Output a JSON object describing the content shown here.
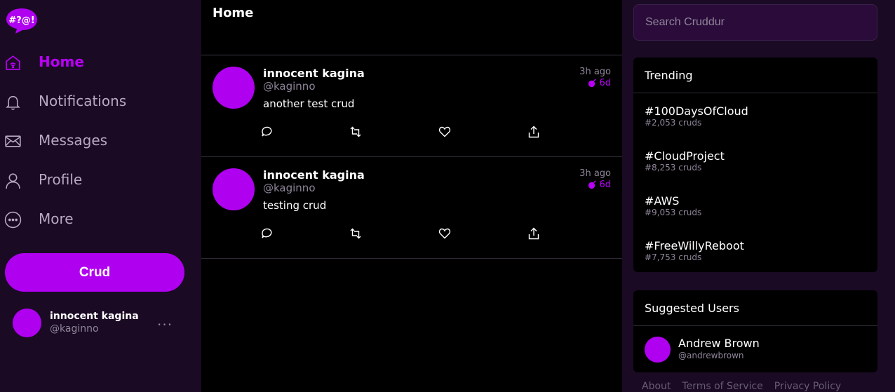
{
  "brand": {
    "logo_text": "#?@!",
    "accent": "#b000f0",
    "background": "#1a0a24"
  },
  "nav": {
    "items": [
      {
        "label": "Home",
        "icon": "home-icon",
        "active": true
      },
      {
        "label": "Notifications",
        "icon": "bell-icon",
        "active": false
      },
      {
        "label": "Messages",
        "icon": "envelope-icon",
        "active": false
      },
      {
        "label": "Profile",
        "icon": "person-icon",
        "active": false
      },
      {
        "label": "More",
        "icon": "more-circle-icon",
        "active": false
      }
    ],
    "crud_button": "Crud"
  },
  "current_user": {
    "name": "innocent kagina",
    "handle": "@kaginno",
    "more": "..."
  },
  "feed": {
    "title": "Home",
    "posts": [
      {
        "name": "innocent kagina",
        "handle": "@kaginno",
        "text": "another test crud",
        "time": "3h ago",
        "expires": "6d"
      },
      {
        "name": "innocent kagina",
        "handle": "@kaginno",
        "text": "testing crud",
        "time": "3h ago",
        "expires": "6d"
      }
    ]
  },
  "search": {
    "placeholder": "Search Cruddur"
  },
  "trending": {
    "title": "Trending",
    "items": [
      {
        "tag": "#100DaysOfCloud",
        "count": "#2,053 cruds"
      },
      {
        "tag": "#CloudProject",
        "count": "#8,253 cruds"
      },
      {
        "tag": "#AWS",
        "count": "#9,053 cruds"
      },
      {
        "tag": "#FreeWillyReboot",
        "count": "#7,753 cruds"
      }
    ]
  },
  "suggested": {
    "title": "Suggested Users",
    "users": [
      {
        "name": "Andrew Brown",
        "handle": "@andrewbrown"
      }
    ]
  },
  "footer": {
    "links": [
      "About",
      "Terms of Service",
      "Privacy Policy"
    ]
  }
}
